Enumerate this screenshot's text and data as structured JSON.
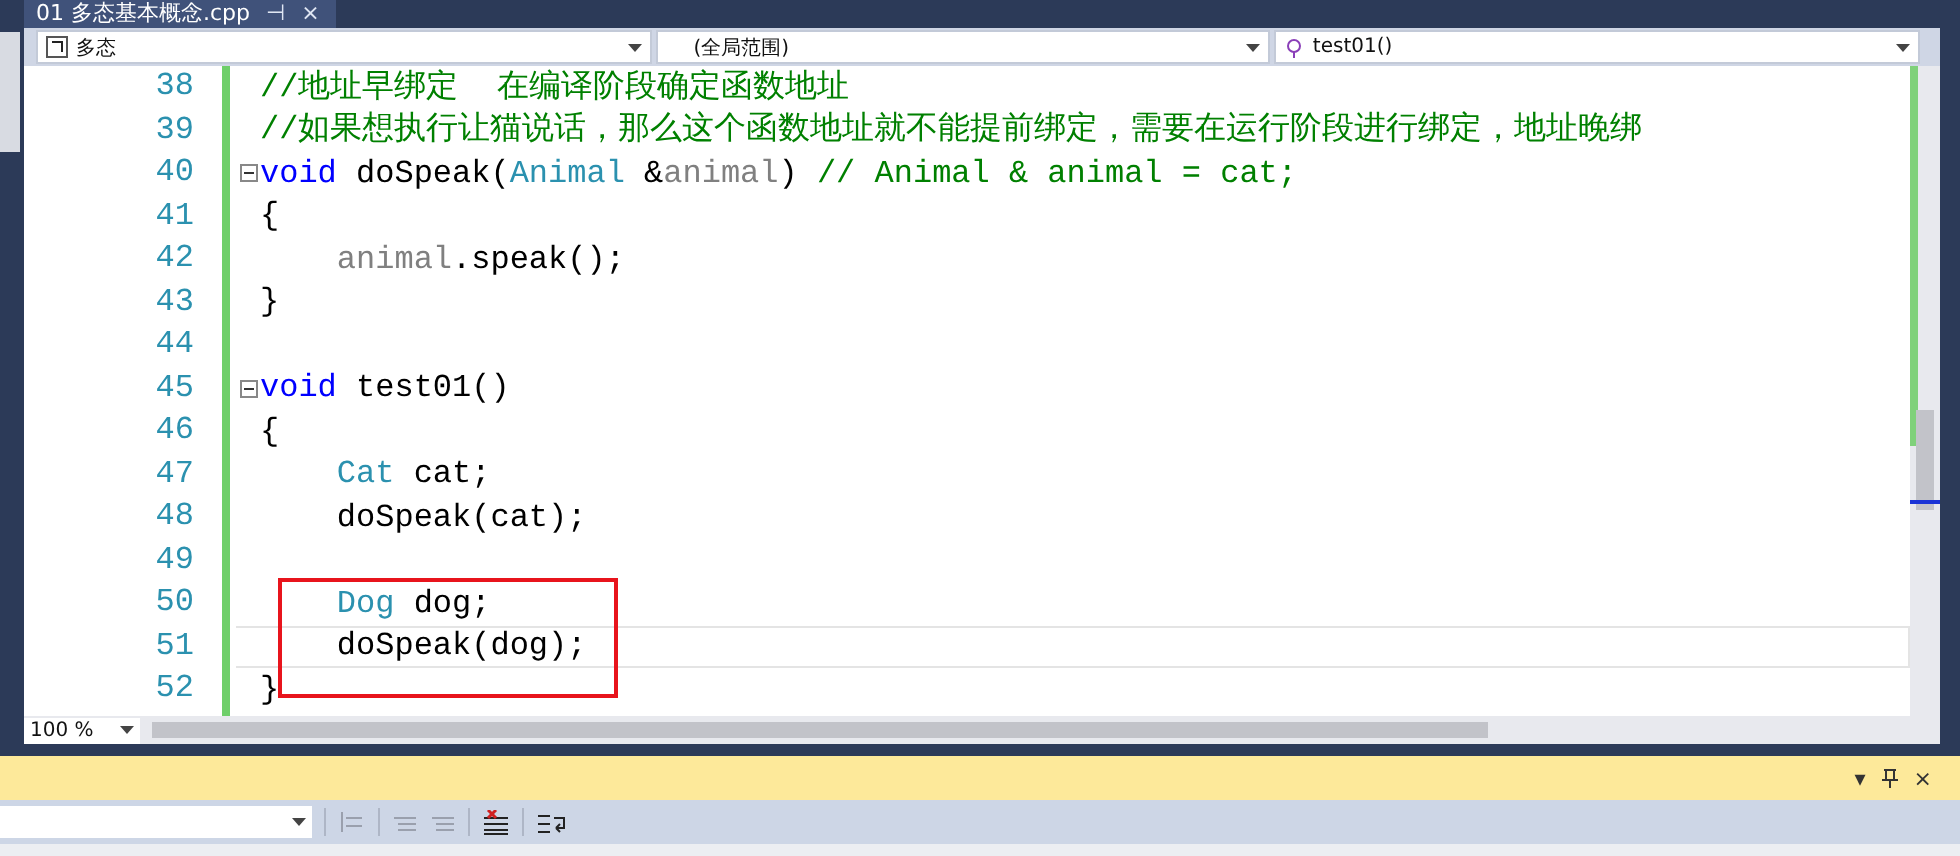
{
  "tab": {
    "title": "01 多态基本概念.cpp",
    "pin": "⊣",
    "close": "×"
  },
  "navigation": [
    {
      "kind": "class",
      "label": "多态"
    },
    {
      "kind": "scope",
      "label": "(全局范围)"
    },
    {
      "kind": "member",
      "label": "test01()"
    }
  ],
  "lines": [
    {
      "number": "38",
      "tokens": [
        {
          "kind": "comment",
          "text": "//地址早绑定  在编译阶段确定函数地址"
        }
      ]
    },
    {
      "number": "39",
      "tokens": [
        {
          "kind": "comment",
          "text": "//如果想执行让猫说话，那么这个函数地址就不能提前绑定，需要在运行阶段进行绑定，地址晚绑"
        }
      ]
    },
    {
      "number": "40",
      "collapsible": true,
      "tokens": [
        {
          "kind": "keyword",
          "text": "void"
        },
        {
          "kind": "plain",
          "text": " doSpeak("
        },
        {
          "kind": "type",
          "text": "Animal"
        },
        {
          "kind": "plain",
          "text": " &"
        },
        {
          "kind": "param",
          "text": "animal"
        },
        {
          "kind": "plain",
          "text": ") "
        },
        {
          "kind": "comment",
          "text": "// Animal & animal = cat;"
        }
      ]
    },
    {
      "number": "41",
      "tokens": [
        {
          "kind": "plain",
          "text": "{"
        }
      ]
    },
    {
      "number": "42",
      "indented": true,
      "tokens": [
        {
          "kind": "param",
          "text": "animal"
        },
        {
          "kind": "plain",
          "text": ".speak();"
        }
      ]
    },
    {
      "number": "43",
      "tokens": [
        {
          "kind": "plain",
          "text": "}"
        }
      ]
    },
    {
      "number": "44"
    },
    {
      "number": "45",
      "collapsible": true,
      "tokens": [
        {
          "kind": "keyword",
          "text": "void"
        },
        {
          "kind": "plain",
          "text": " test01()"
        }
      ]
    },
    {
      "number": "46",
      "tokens": [
        {
          "kind": "plain",
          "text": "{"
        }
      ]
    },
    {
      "number": "47",
      "indented": true,
      "tokens": [
        {
          "kind": "type",
          "text": "Cat"
        },
        {
          "kind": "plain",
          "text": " cat;"
        }
      ]
    },
    {
      "number": "48",
      "indented": true,
      "tokens": [
        {
          "kind": "plain",
          "text": "doSpeak(cat);"
        }
      ]
    },
    {
      "number": "49"
    },
    {
      "number": "50",
      "boxed": true,
      "indented": true,
      "tokens": [
        {
          "kind": "type",
          "text": "Dog"
        },
        {
          "kind": "plain",
          "text": " dog;"
        }
      ]
    },
    {
      "number": "51",
      "boxed": true,
      "current": true,
      "indented": true,
      "tokens": [
        {
          "kind": "plain",
          "text": "doSpeak(dog);"
        }
      ]
    },
    {
      "number": "52",
      "tokens": [
        {
          "kind": "plain",
          "text": "}"
        }
      ]
    }
  ],
  "zoom": "100 %",
  "output_panel": {
    "menu": "▾",
    "close": "×"
  }
}
